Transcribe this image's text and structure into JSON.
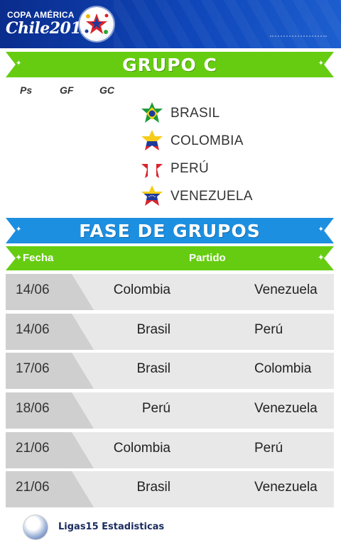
{
  "header": {
    "brand_top": "COPA AMÉRICA",
    "brand_bottom": "Chile2015",
    "colors": {
      "bg": "#0f46b9"
    }
  },
  "group_banner": {
    "title": "GRUPO C",
    "color": "#66cc11"
  },
  "stats_columns": [
    "Ps",
    "GF",
    "GC"
  ],
  "teams": [
    {
      "name": "BRASIL",
      "flag_icon": "brazil-flag-star-icon"
    },
    {
      "name": "COLOMBIA",
      "flag_icon": "colombia-flag-star-icon"
    },
    {
      "name": "PERÚ",
      "flag_icon": "peru-flag-star-icon"
    },
    {
      "name": "VENEZUELA",
      "flag_icon": "venezuela-flag-star-icon"
    }
  ],
  "phase_banner": {
    "title": "FASE DE GRUPOS",
    "color": "#1d8fe1"
  },
  "table_header": {
    "fecha": "Fecha",
    "partido": "Partido"
  },
  "matches": [
    {
      "date": "14/06",
      "home": "Colombia",
      "away": "Venezuela"
    },
    {
      "date": "14/06",
      "home": "Brasil",
      "away": "Perú"
    },
    {
      "date": "17/06",
      "home": "Brasil",
      "away": "Colombia"
    },
    {
      "date": "18/06",
      "home": "Perú",
      "away": "Venezuela"
    },
    {
      "date": "21/06",
      "home": "Colombia",
      "away": "Perú"
    },
    {
      "date": "21/06",
      "home": "Brasil",
      "away": "Venezuela"
    }
  ],
  "footer": {
    "text": "Ligas15 Estadisticas"
  }
}
